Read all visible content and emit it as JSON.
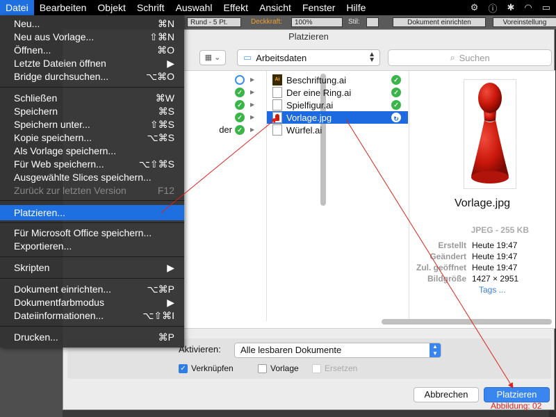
{
  "menubar": {
    "items": [
      "Datei",
      "Bearbeiten",
      "Objekt",
      "Schrift",
      "Auswahl",
      "Effekt",
      "Ansicht",
      "Fenster",
      "Hilfe"
    ]
  },
  "appbar": {
    "stroke_label": "Rund - 5 Pt.",
    "opacity_label": "Deckkraft:",
    "opacity_value": "100%",
    "style_label": "Stil:",
    "doc_setup_button": "Dokument einrichten",
    "prefs_button": "Voreinstellung"
  },
  "menu": {
    "items": [
      {
        "label": "Neu...",
        "shortcut": "⌘N"
      },
      {
        "label": "Neu aus Vorlage...",
        "shortcut": "⇧⌘N"
      },
      {
        "label": "Öffnen...",
        "shortcut": "⌘O"
      },
      {
        "label": "Letzte Dateien öffnen",
        "shortcut": "▶"
      },
      {
        "label": "Bridge durchsuchen...",
        "shortcut": "⌥⌘O"
      },
      {
        "label": "Schließen",
        "shortcut": "⌘W"
      },
      {
        "label": "Speichern",
        "shortcut": "⌘S"
      },
      {
        "label": "Speichern unter...",
        "shortcut": "⇧⌘S"
      },
      {
        "label": "Kopie speichern...",
        "shortcut": "⌥⌘S"
      },
      {
        "label": "Als Vorlage speichern...",
        "shortcut": ""
      },
      {
        "label": "Für Web speichern...",
        "shortcut": "⌥⇧⌘S"
      },
      {
        "label": "Ausgewählte Slices speichern...",
        "shortcut": ""
      },
      {
        "label": "Zurück zur letzten Version",
        "shortcut": "F12"
      },
      {
        "label": "Platzieren...",
        "shortcut": ""
      },
      {
        "label": "Für Microsoft Office speichern...",
        "shortcut": ""
      },
      {
        "label": "Exportieren...",
        "shortcut": ""
      },
      {
        "label": "Skripten",
        "shortcut": "▶"
      },
      {
        "label": "Dokument einrichten...",
        "shortcut": "⌥⌘P"
      },
      {
        "label": "Dokumentfarbmodus",
        "shortcut": "▶"
      },
      {
        "label": "Dateiinformationen...",
        "shortcut": "⌥⇧⌘I"
      },
      {
        "label": "Drucken...",
        "shortcut": "⌘P"
      }
    ]
  },
  "dialog": {
    "title": "Platzieren",
    "folder": "Arbeitsdaten",
    "search_placeholder": "Suchen",
    "col1_fragment": "der",
    "files": [
      {
        "name": "Beschriftung.ai"
      },
      {
        "name": "Der eine Ring.ai"
      },
      {
        "name": "Spielfigur.ai"
      },
      {
        "name": "Vorlage.jpg"
      },
      {
        "name": "Würfel.ai"
      }
    ],
    "preview": {
      "filename": "Vorlage.jpg",
      "type": "JPEG - 255 KB",
      "meta": [
        {
          "key": "Erstellt",
          "value": "Heute 19:47"
        },
        {
          "key": "Geändert",
          "value": "Heute 19:47"
        },
        {
          "key": "Zul. geöffnet",
          "value": "Heute 19:47"
        },
        {
          "key": "Bildgröße",
          "value": "1427 × 2951"
        }
      ],
      "tags_link": "Tags ..."
    },
    "enable_label": "Aktivieren:",
    "enable_value": "Alle lesbaren Dokumente",
    "checkbox_link": "Verknüpfen",
    "checkbox_template": "Vorlage",
    "checkbox_replace": "Ersetzen",
    "cancel": "Abbrechen",
    "place": "Platzieren"
  },
  "caption": "Abbildung: 02",
  "colors": {
    "accent": "#1e6fe0",
    "annotation": "#e0201a"
  }
}
